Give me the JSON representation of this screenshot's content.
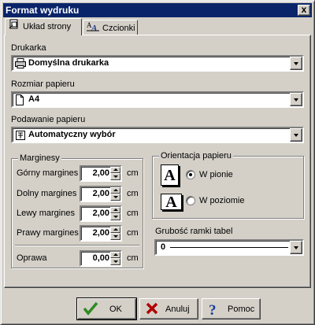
{
  "window": {
    "title": "Format wydruku",
    "close_glyph": "x"
  },
  "tabs": [
    {
      "label": "Układ strony",
      "icon": "page-setup-icon"
    },
    {
      "label": "Czcionki",
      "icon": "font-icon"
    }
  ],
  "printer": {
    "label": "Drukarka",
    "value": "Domyślna drukarka",
    "icon": "printer-icon"
  },
  "paper_size": {
    "label": "Rozmiar papieru",
    "value": "A4",
    "icon": "page-icon"
  },
  "paper_source": {
    "label": "Podawanie papieru",
    "value": "Automatyczny wybór",
    "icon": "tray-icon"
  },
  "margins": {
    "title": "Marginesy",
    "unit": "cm",
    "rows": [
      {
        "label": "Górny margines",
        "value": "2,00"
      },
      {
        "label": "Dolny margines",
        "value": "2,00"
      },
      {
        "label": "Lewy margines",
        "value": "2,00"
      },
      {
        "label": "Prawy margines",
        "value": "2,00"
      }
    ],
    "binding": {
      "label": "Oprawa",
      "value": "0,00"
    }
  },
  "orientation": {
    "title": "Orientacja papieru",
    "portrait_label": "W pionie",
    "landscape_label": "W poziomie",
    "icon_letter": "A",
    "selected": "portrait"
  },
  "table_border": {
    "label": "Grubość ramki tabel",
    "value": "0"
  },
  "buttons": {
    "ok": "OK",
    "cancel": "Anuluj",
    "help": "Pomoc"
  },
  "colors": {
    "titlebar": "#0a246a",
    "dialog": "#d4d0c8",
    "ok_check": "#2e8b22",
    "cancel_x": "#b00000",
    "help_q": "#1a3c9c"
  }
}
